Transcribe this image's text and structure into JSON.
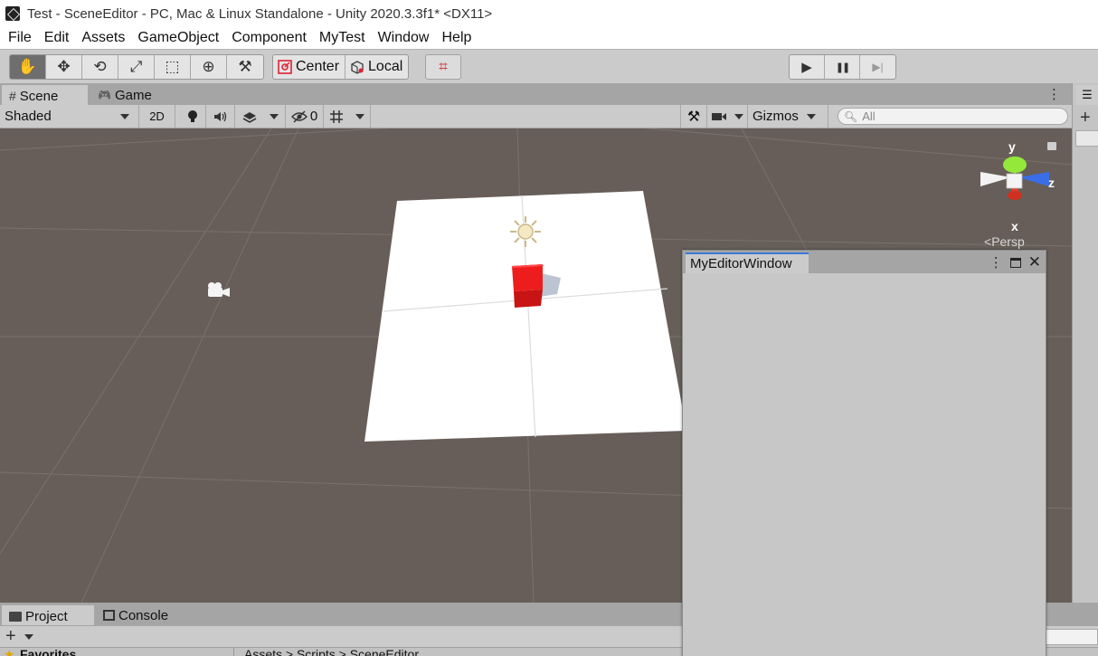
{
  "window": {
    "title": "Test - SceneEditor - PC, Mac & Linux Standalone - Unity 2020.3.3f1* <DX11>"
  },
  "menu": [
    "File",
    "Edit",
    "Assets",
    "GameObject",
    "Component",
    "MyTest",
    "Window",
    "Help"
  ],
  "toolbar": {
    "tools": [
      {
        "name": "hand-tool",
        "icon": "hand-icon",
        "glyph": "✋",
        "active": true
      },
      {
        "name": "move-tool",
        "icon": "move-icon",
        "glyph": "✥",
        "active": false
      },
      {
        "name": "rotate-tool",
        "icon": "rotate-icon",
        "glyph": "⟲",
        "active": false
      },
      {
        "name": "scale-tool",
        "icon": "scale-icon",
        "glyph": "⤢",
        "active": false
      },
      {
        "name": "rect-tool",
        "icon": "rect-icon",
        "glyph": "⬚",
        "active": false
      },
      {
        "name": "transform-tool",
        "icon": "transform-icon",
        "glyph": "⊕",
        "active": false
      },
      {
        "name": "custom-tool",
        "icon": "wrench-icon",
        "glyph": "⚒",
        "active": false
      }
    ],
    "pivot_label": "Center",
    "space_label": "Local",
    "snap_glyph": "⌗",
    "play_glyph": "▶",
    "pause_glyph": "❚❚",
    "step_glyph": "▶|"
  },
  "scene_tabs": {
    "scene_label": "Scene",
    "game_label": "Game",
    "scene_icon_glyph": "#",
    "game_icon_glyph": "🎮"
  },
  "scene_toolbar": {
    "shading_mode": "Shaded",
    "mode_2d": "2D",
    "hidden_count": "0",
    "gizmos_label": "Gizmos",
    "search_placeholder": "All"
  },
  "gizmo": {
    "y_label": "y",
    "z_label": "z",
    "x_label": "x",
    "projection_label": "Persp",
    "colors": {
      "y": "#94e83a",
      "z": "#3a6de8",
      "x": "#e83a2a"
    }
  },
  "scene_objects": {
    "plane_color": "#ffffff",
    "cube_color": "#e82020",
    "background_color": "#675e59"
  },
  "editor_window": {
    "tab_label": "MyEditorWindow",
    "accent_color": "#3a79d8"
  },
  "project_tabs": {
    "project_label": "Project",
    "console_label": "Console"
  },
  "project_panel": {
    "favorites_label": "Favorites",
    "path_label": "Assets > Scripts > SceneEditor"
  }
}
